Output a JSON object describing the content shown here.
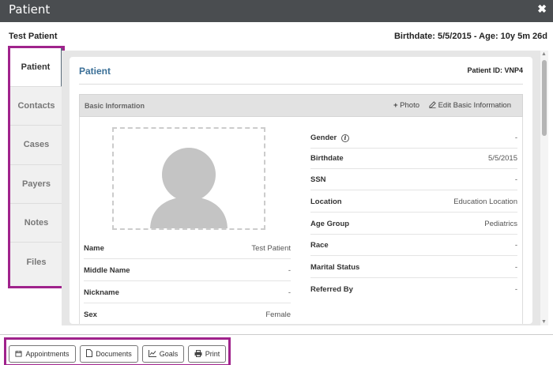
{
  "window": {
    "title": "Patient",
    "close_glyph": "✖"
  },
  "header": {
    "patient_name": "Test Patient",
    "birthdate_age": "Birthdate: 5/5/2015 - Age: 10y 5m 26d"
  },
  "sidebar": {
    "items": [
      {
        "label": "Patient",
        "active": true
      },
      {
        "label": "Contacts"
      },
      {
        "label": "Cases"
      },
      {
        "label": "Payers"
      },
      {
        "label": "Notes"
      },
      {
        "label": "Files"
      }
    ]
  },
  "panel": {
    "title": "Patient",
    "patient_id": "Patient ID: VNP4",
    "basic_info": {
      "title": "Basic Information",
      "photo_label": "Photo",
      "photo_icon": "plus-icon",
      "edit_label": "Edit Basic Information",
      "edit_icon": "edit-icon"
    },
    "left_fields": [
      {
        "label": "Name",
        "value": "Test Patient"
      },
      {
        "label": "Middle Name",
        "value": "-"
      },
      {
        "label": "Nickname",
        "value": "-"
      },
      {
        "label": "Sex",
        "value": "Female"
      }
    ],
    "right_fields": [
      {
        "label": "Gender",
        "value": "-"
      },
      {
        "label": "Birthdate",
        "value": "5/5/2015"
      },
      {
        "label": "SSN",
        "value": "-"
      },
      {
        "label": "Location",
        "value": "Education Location"
      },
      {
        "label": "Age Group",
        "value": "Pediatrics"
      },
      {
        "label": "Race",
        "value": "-"
      },
      {
        "label": "Marital Status",
        "value": "-"
      },
      {
        "label": "Referred By",
        "value": "-"
      }
    ],
    "info_glyph": "i"
  },
  "footer": {
    "buttons": [
      {
        "label": "Appointments",
        "icon": "calendar-icon"
      },
      {
        "label": "Documents",
        "icon": "document-icon"
      },
      {
        "label": "Goals",
        "icon": "chart-icon"
      },
      {
        "label": "Print",
        "icon": "print-icon"
      }
    ]
  },
  "colors": {
    "titlebar": "#4a4d50",
    "highlight": "#a0238c",
    "panel_title": "#3a6f97"
  }
}
